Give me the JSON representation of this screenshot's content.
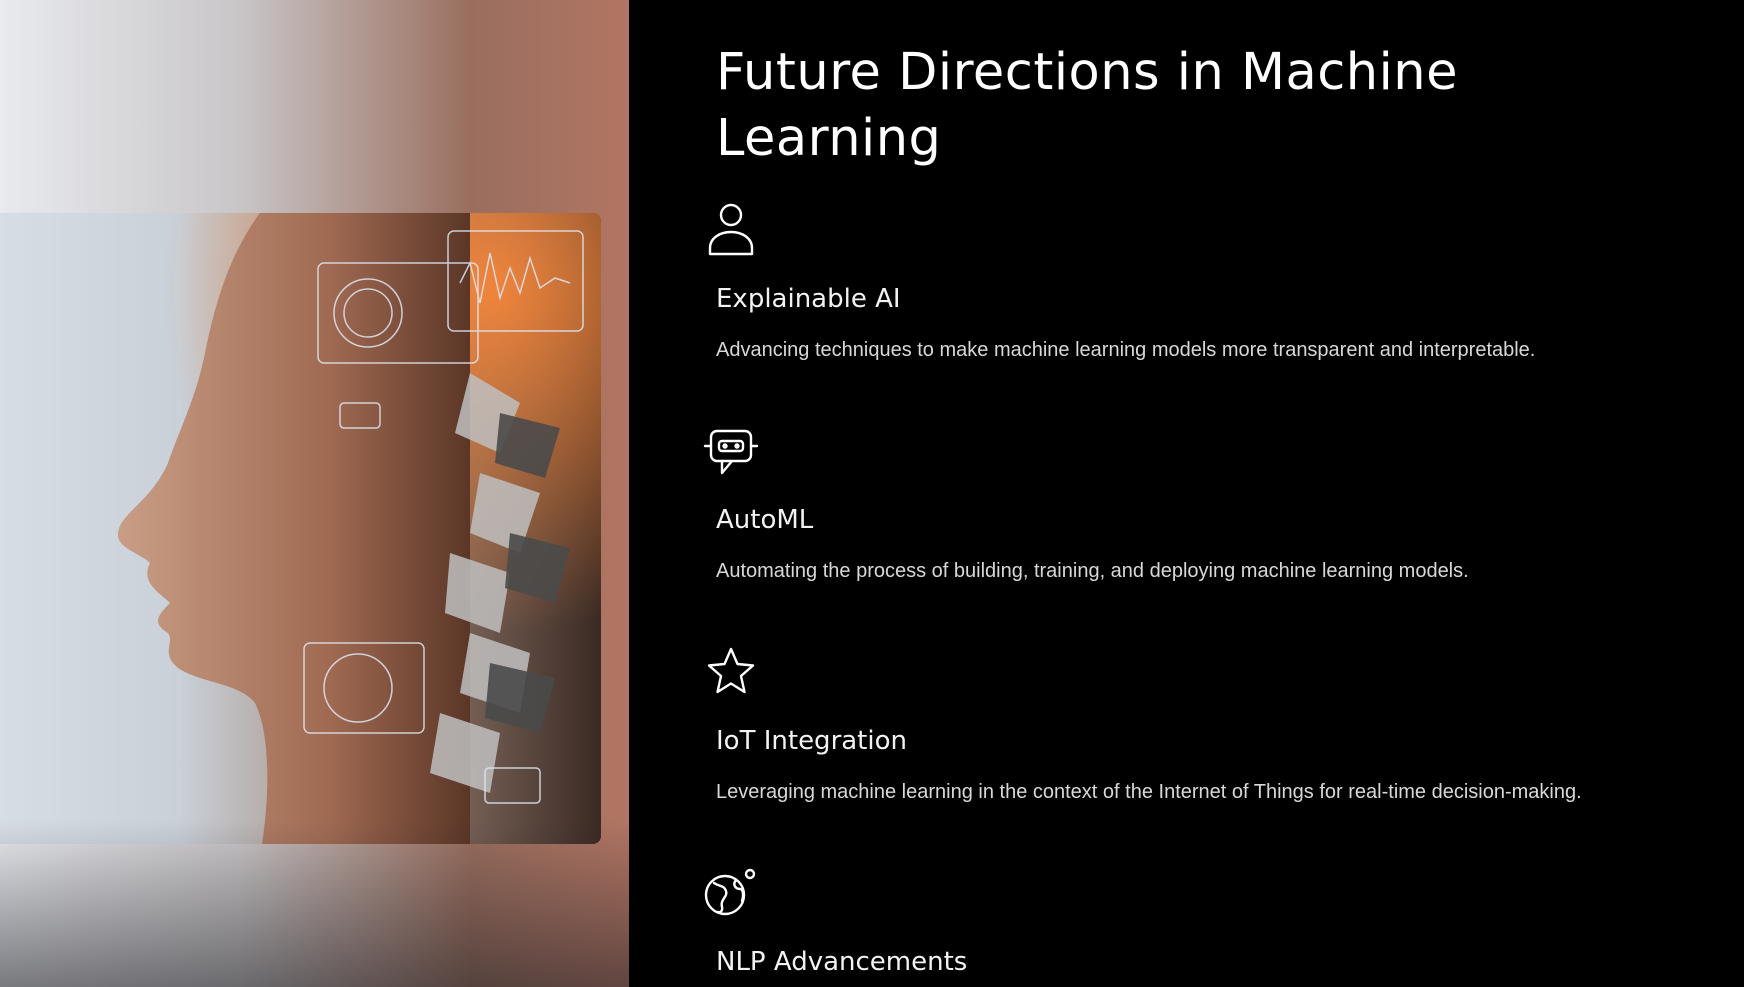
{
  "slide": {
    "title": "Future Directions in Machine Learning",
    "items": [
      {
        "icon": "person-icon",
        "heading": "Explainable AI",
        "description": "Advancing techniques to make machine learning models more transparent and interpretable."
      },
      {
        "icon": "robot-chat-icon",
        "heading": "AutoML",
        "description": "Automating the process of building, training, and deploying machine learning models."
      },
      {
        "icon": "star-icon",
        "heading": "IoT Integration",
        "description": "Leveraging machine learning in the context of the Internet of Things for real-time decision-making."
      },
      {
        "icon": "globe-icon",
        "heading": "NLP Advancements",
        "description": ""
      }
    ]
  },
  "colors": {
    "background": "#000000",
    "title": "#ffffff",
    "heading": "#f2f2f2",
    "body_text": "#d8d8d8"
  }
}
